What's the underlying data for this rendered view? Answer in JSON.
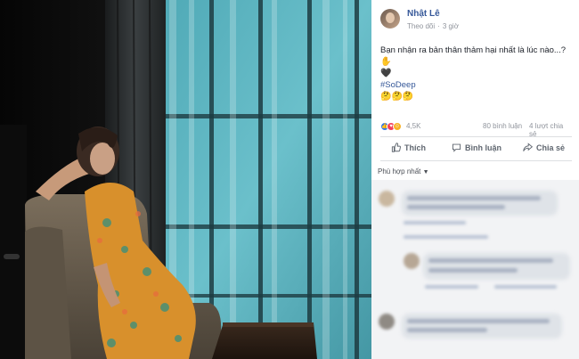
{
  "post": {
    "author": "Nhật Lê",
    "follow_label": "Theo dõi",
    "separator": "·",
    "time": "3 giờ",
    "caption_text": "Bạn nhận ra bản thân thảm hại nhất là lúc nào...?",
    "caption_emoji_hand": "✋",
    "caption_heart": "🖤",
    "hashtag": "#SoDeep",
    "hashtag_emojis": "🤔🤔🤔",
    "reactions_count": "4,5K",
    "comments_count": "80 bình luận",
    "shares_count": "4 lượt chia sẻ"
  },
  "actions": {
    "like_label": "Thích",
    "comment_label": "Bình luận",
    "share_label": "Chia sẻ"
  },
  "comments": {
    "sort_label": "Phù hợp nhất"
  },
  "colors": {
    "link": "#365899",
    "secondary_text": "#90949c",
    "like_blue": "#3578e5",
    "love_red": "#f33e58",
    "haha_yellow": "#f7b125"
  },
  "icons": {
    "like": "thumbs-up-icon",
    "comment": "speech-bubble-icon",
    "share": "share-arrow-icon",
    "sort": "caret-down-icon"
  }
}
